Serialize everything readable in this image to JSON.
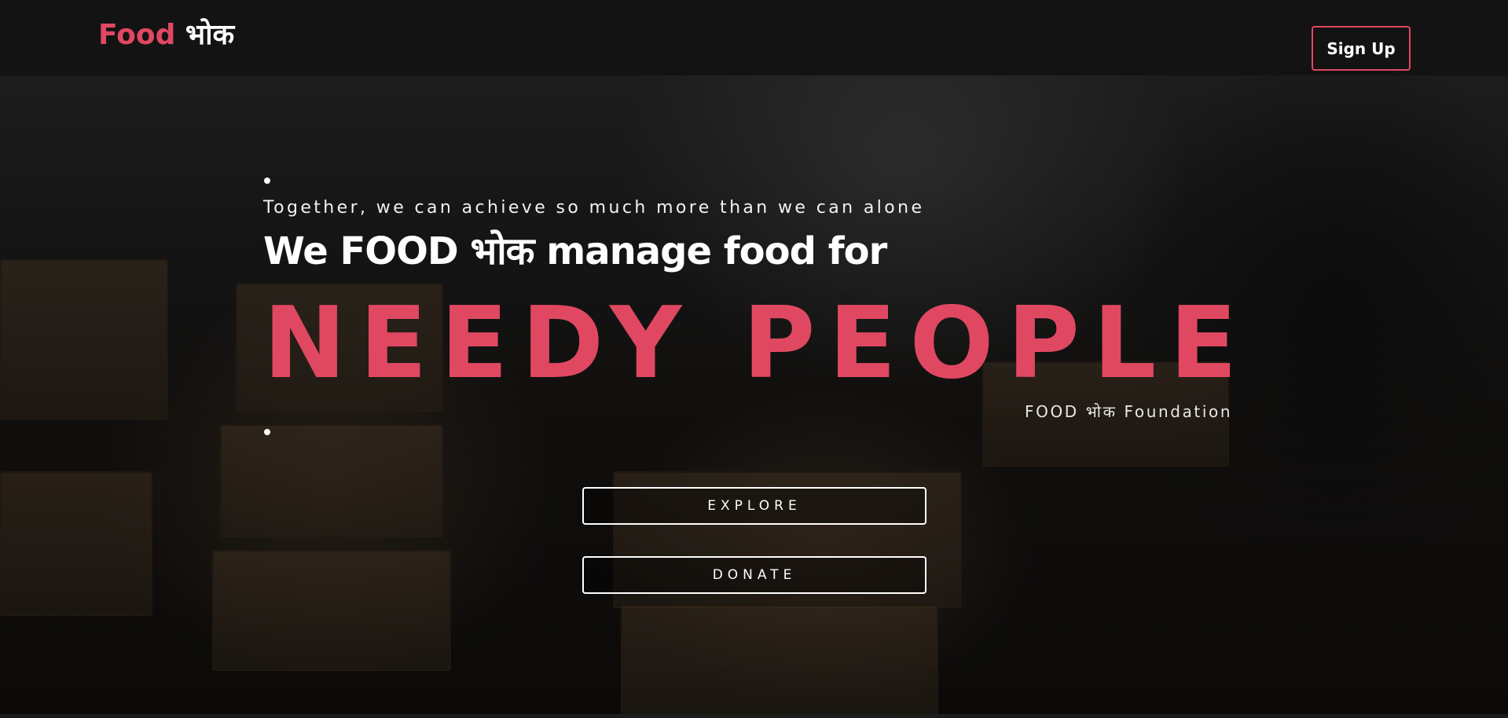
{
  "navbar": {
    "logo_food": "Food",
    "logo_bhok": "भोक",
    "signup_label": "Sign Up"
  },
  "hero": {
    "tagline": "Together, we can achieve so much more than we can alone",
    "headline": "We FOOD भोक manage food for",
    "big_text": "NEEDY PEOPLE",
    "foundation": "FOOD भोक Foundation",
    "explore_label": "EXPLORE",
    "donate_label": "DONATE"
  },
  "colors": {
    "accent": "#e04862",
    "navbar_bg": "#121212",
    "text": "#ffffff"
  }
}
